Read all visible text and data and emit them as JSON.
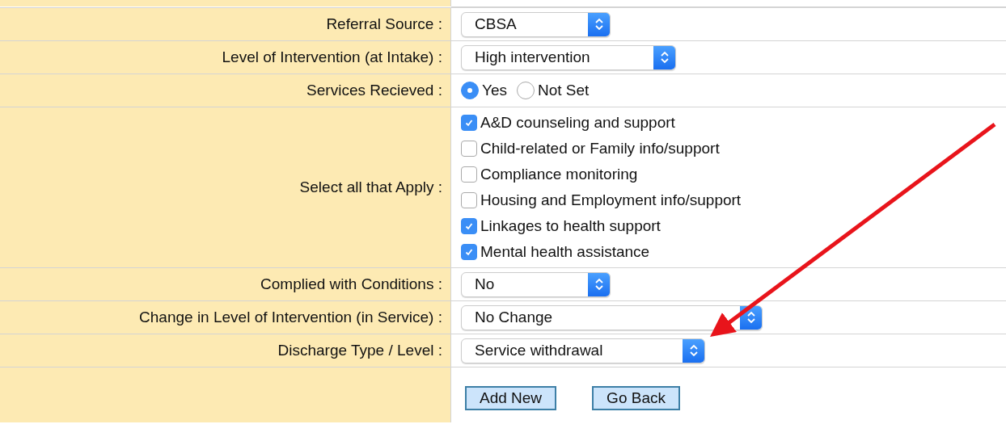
{
  "rows": [
    {
      "kind": "select",
      "label": "Referral Source :",
      "value": "CBSA"
    },
    {
      "kind": "select",
      "label": "Level of Intervention (at Intake) :",
      "value": "High intervention"
    },
    {
      "kind": "radio",
      "label": "Services Recieved :",
      "options": [
        {
          "label": "Yes",
          "selected": true
        },
        {
          "label": "Not Set",
          "selected": false
        }
      ]
    },
    {
      "kind": "checkboxes",
      "label": "Select all that Apply :",
      "options": [
        {
          "label": "A&D counseling and support",
          "checked": true
        },
        {
          "label": "Child-related or Family info/support",
          "checked": false
        },
        {
          "label": "Compliance monitoring",
          "checked": false
        },
        {
          "label": "Housing and Employment info/support",
          "checked": false
        },
        {
          "label": "Linkages to health support",
          "checked": true
        },
        {
          "label": "Mental health assistance",
          "checked": true
        }
      ]
    },
    {
      "kind": "select",
      "label": "Complied with Conditions :",
      "value": "No"
    },
    {
      "kind": "select",
      "label": "Change in Level of Intervention (in Service) :",
      "value": "No Change"
    },
    {
      "kind": "select",
      "label": "Discharge Type / Level :",
      "value": "Service withdrawal"
    },
    {
      "kind": "buttons",
      "buttons": [
        "Add New",
        "Go Back"
      ]
    }
  ]
}
